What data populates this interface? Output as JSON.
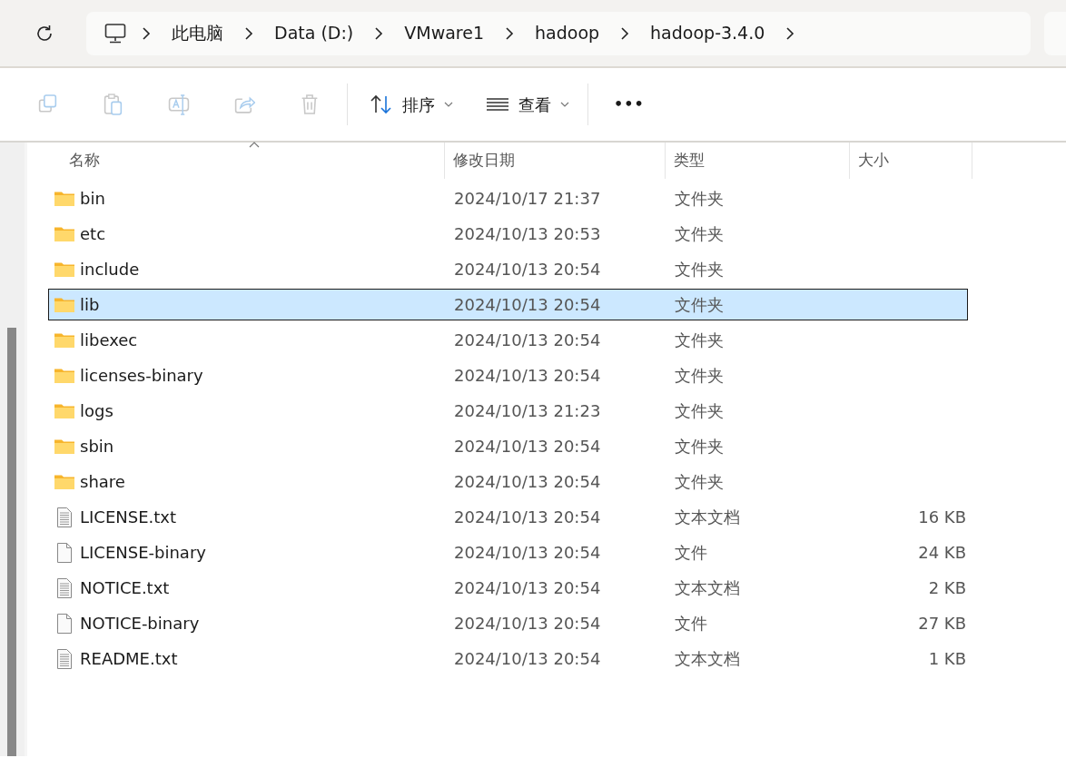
{
  "breadcrumb": [
    "此电脑",
    "Data (D:)",
    "VMware1",
    "hadoop",
    "hadoop-3.4.0"
  ],
  "toolbar": {
    "disabled_actions": true,
    "sort_label": "排序",
    "view_label": "查看",
    "more": "•••"
  },
  "columns": [
    "名称",
    "修改日期",
    "类型",
    "大小"
  ],
  "rows": [
    {
      "kind": "folder",
      "name": "bin",
      "date": "2024/10/17 21:37",
      "type": "文件夹",
      "selected": false
    },
    {
      "kind": "folder",
      "name": "etc",
      "date": "2024/10/13 20:53",
      "type": "文件夹",
      "selected": false
    },
    {
      "kind": "folder",
      "name": "include",
      "date": "2024/10/13 20:54",
      "type": "文件夹",
      "selected": false
    },
    {
      "kind": "folder",
      "name": "lib",
      "date": "2024/10/13 20:54",
      "type": "文件夹",
      "selected": true
    },
    {
      "kind": "folder",
      "name": "libexec",
      "date": "2024/10/13 20:54",
      "type": "文件夹",
      "selected": false
    },
    {
      "kind": "folder",
      "name": "licenses-binary",
      "date": "2024/10/13 20:54",
      "type": "文件夹",
      "selected": false
    },
    {
      "kind": "folder",
      "name": "logs",
      "date": "2024/10/13 21:23",
      "type": "文件夹",
      "selected": false
    },
    {
      "kind": "folder",
      "name": "sbin",
      "date": "2024/10/13 20:54",
      "type": "文件夹",
      "selected": false
    },
    {
      "kind": "folder",
      "name": "share",
      "date": "2024/10/13 20:54",
      "type": "文件夹",
      "selected": false
    },
    {
      "kind": "text",
      "name": "LICENSE.txt",
      "date": "2024/10/13 20:54",
      "type": "文本文档",
      "size": "16 KB",
      "selected": false
    },
    {
      "kind": "file",
      "name": "LICENSE-binary",
      "date": "2024/10/13 20:54",
      "type": "文件",
      "size": "24 KB",
      "selected": false
    },
    {
      "kind": "text",
      "name": "NOTICE.txt",
      "date": "2024/10/13 20:54",
      "type": "文本文档",
      "size": "2 KB",
      "selected": false
    },
    {
      "kind": "file",
      "name": "NOTICE-binary",
      "date": "2024/10/13 20:54",
      "type": "文件",
      "size": "27 KB",
      "selected": false
    },
    {
      "kind": "text",
      "name": "README.txt",
      "date": "2024/10/13 20:54",
      "type": "文本文档",
      "size": "1 KB",
      "selected": false
    }
  ]
}
